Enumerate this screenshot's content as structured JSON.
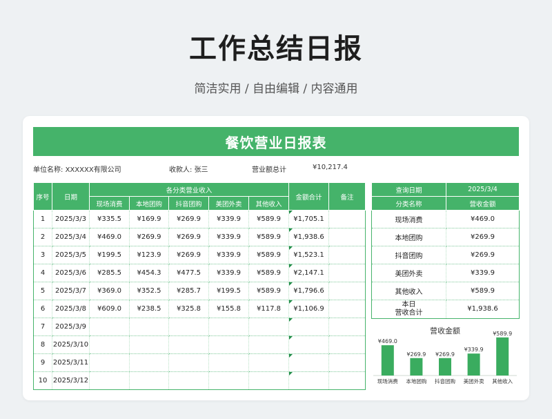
{
  "page": {
    "title": "工作总结日报",
    "subtitle": "简洁实用 / 自由编辑 / 内容通用"
  },
  "report": {
    "title": "餐饮营业日报表",
    "unit_label": "单位名称:",
    "unit_value": "XXXXXX有限公司",
    "cashier_label": "收款人:",
    "cashier_value": "张三",
    "total_label": "营业额总计",
    "total_value": "¥10,217.4"
  },
  "table": {
    "headers": {
      "index": "序号",
      "date": "日期",
      "category_group": "各分类营业收入",
      "categories": [
        "现场消费",
        "本地团购",
        "抖音团购",
        "美团外卖",
        "其他收入"
      ],
      "total": "金额合计",
      "note": "备注"
    },
    "rows": [
      {
        "idx": "1",
        "date": "2025/3/3",
        "v": [
          "¥335.5",
          "¥169.9",
          "¥269.9",
          "¥339.9",
          "¥589.9"
        ],
        "total": "¥1,705.1",
        "note": ""
      },
      {
        "idx": "2",
        "date": "2025/3/4",
        "v": [
          "¥469.0",
          "¥269.9",
          "¥269.9",
          "¥339.9",
          "¥589.9"
        ],
        "total": "¥1,938.6",
        "note": ""
      },
      {
        "idx": "3",
        "date": "2025/3/5",
        "v": [
          "¥199.5",
          "¥123.9",
          "¥269.9",
          "¥339.9",
          "¥589.9"
        ],
        "total": "¥1,523.1",
        "note": ""
      },
      {
        "idx": "4",
        "date": "2025/3/6",
        "v": [
          "¥285.5",
          "¥454.3",
          "¥477.5",
          "¥339.9",
          "¥589.9"
        ],
        "total": "¥2,147.1",
        "note": ""
      },
      {
        "idx": "5",
        "date": "2025/3/7",
        "v": [
          "¥369.0",
          "¥352.5",
          "¥285.7",
          "¥199.5",
          "¥589.9"
        ],
        "total": "¥1,796.6",
        "note": ""
      },
      {
        "idx": "6",
        "date": "2025/3/8",
        "v": [
          "¥609.0",
          "¥238.5",
          "¥325.8",
          "¥155.8",
          "¥117.8"
        ],
        "total": "¥1,106.9",
        "note": ""
      },
      {
        "idx": "7",
        "date": "2025/3/9",
        "v": [
          "",
          "",
          "",
          "",
          ""
        ],
        "total": "",
        "note": ""
      },
      {
        "idx": "8",
        "date": "2025/3/10",
        "v": [
          "",
          "",
          "",
          "",
          ""
        ],
        "total": "",
        "note": ""
      },
      {
        "idx": "9",
        "date": "2025/3/11",
        "v": [
          "",
          "",
          "",
          "",
          ""
        ],
        "total": "",
        "note": ""
      },
      {
        "idx": "10",
        "date": "2025/3/12",
        "v": [
          "",
          "",
          "",
          "",
          ""
        ],
        "total": "",
        "note": ""
      }
    ]
  },
  "summary": {
    "query_label": "查询日期",
    "query_date": "2025/3/4",
    "col_category": "分类名称",
    "col_amount": "营收金额",
    "rows": [
      {
        "name": "现场消费",
        "amount": "¥469.0"
      },
      {
        "name": "本地团购",
        "amount": "¥269.9"
      },
      {
        "name": "抖音团购",
        "amount": "¥269.9"
      },
      {
        "name": "美团外卖",
        "amount": "¥339.9"
      },
      {
        "name": "其他收入",
        "amount": "¥589.9"
      }
    ],
    "total_label_1": "本日",
    "total_label_2": "营收合计",
    "total_value": "¥1,938.6"
  },
  "colors": {
    "accent": "#45b36a",
    "bar": "#3aac5f",
    "background": "#eef1f3"
  },
  "chart_data": {
    "type": "bar",
    "title": "营收金额",
    "categories": [
      "现场消费",
      "本地团购",
      "抖音团购",
      "美团外卖",
      "其他收入"
    ],
    "values": [
      469.0,
      269.9,
      269.9,
      339.9,
      589.9
    ],
    "data_labels": [
      "¥469.0",
      "¥269.9",
      "¥269.9",
      "¥339.9",
      "¥589.9"
    ],
    "ylim": [
      0,
      620
    ],
    "grid": false,
    "legend": "none"
  }
}
